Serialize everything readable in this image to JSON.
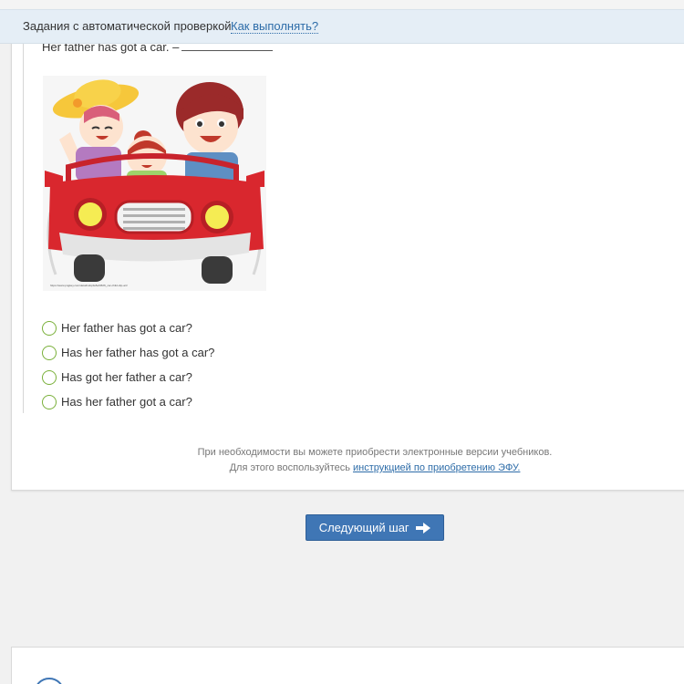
{
  "header": {
    "title": "Задания с автоматической проверкой",
    "help_link": "Как выполнять?"
  },
  "task": {
    "sentence": "Her father has got a car. –",
    "picture_caption": "https://www.pngkey.com/detail/u2q4w5e6t5r8t_car-child-clip-art/",
    "options": [
      "Her father has got a car?",
      "Has her father has got a car?",
      "Has got her father a car?",
      "Has her father got a car?"
    ]
  },
  "note": {
    "line1": "При необходимости вы можете приобрести электронные версии учебников.",
    "line2_prefix": "Для этого воспользуйтесь",
    "line2_link": "инструкцией по приобретению ЭФУ."
  },
  "next_button": {
    "label": "Следующий шаг"
  },
  "colors": {
    "accent": "#3f76b5",
    "header_bg": "#e5eef6",
    "radio_border": "#7ab03a",
    "link": "#2d6ca8"
  },
  "icons": {
    "next_arrow": "arrow-right-icon",
    "bottom_circle": "circle-icon"
  }
}
